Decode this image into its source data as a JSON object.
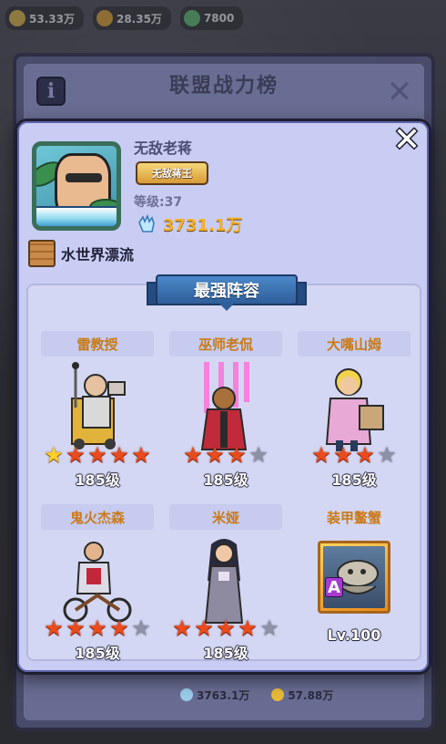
{
  "top_bar": {
    "resources": [
      {
        "icon": "coin-icon",
        "value": "53.33万",
        "color": "#f2c23a"
      },
      {
        "icon": "gold-icon",
        "value": "28.35万",
        "color": "#f0a51e"
      },
      {
        "icon": "gem-icon",
        "value": "7800",
        "color": "#52c768"
      }
    ]
  },
  "back_panel": {
    "title": "联盟战力榜",
    "info_label": "i",
    "footer": {
      "power": "3763.1万",
      "score": "57.88万"
    }
  },
  "popup": {
    "player": {
      "name": "无敌老蒋",
      "title_badge": "无敌蒋王",
      "level": "等级:37",
      "power": "3731.1万",
      "alliance": "水世界漂流"
    },
    "lineup": {
      "banner": "最强阵容",
      "heroes": [
        {
          "name": "雷教授",
          "level": "185级",
          "stars": 5,
          "first_star_gold": true
        },
        {
          "name": "巫师老侃",
          "level": "185级",
          "stars": 3,
          "first_star_gold": false
        },
        {
          "name": "大嘴山姆",
          "level": "185级",
          "stars": 3,
          "first_star_gold": false
        },
        {
          "name": "鬼火杰森",
          "level": "185级",
          "stars": 4,
          "first_star_gold": false
        },
        {
          "name": "米娅",
          "level": "185级",
          "stars": 4,
          "first_star_gold": false
        }
      ],
      "pet": {
        "name": "装甲鳌蟹",
        "grade": "A",
        "level": "Lv.100"
      }
    }
  },
  "colors": {
    "popup_bg": "#c9cdf3",
    "hero_name": "#c97a18",
    "power_value": "#f3b02a",
    "banner": "#2f5e9a",
    "star_on": "#ea4b1c",
    "star_off": "#8e90a6"
  }
}
